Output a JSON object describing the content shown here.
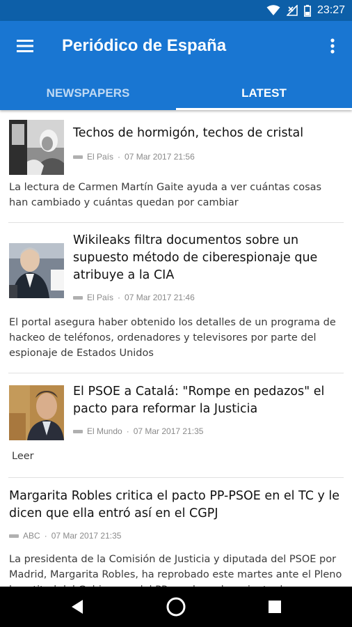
{
  "status_bar": {
    "time": "23:27",
    "icons": [
      "wifi-icon",
      "signal-off-icon",
      "battery-icon"
    ]
  },
  "app_bar": {
    "title": "Periódico de España",
    "menu_icon": "hamburger-menu-icon",
    "overflow_icon": "more-vert-icon"
  },
  "tabs": [
    {
      "label": "NEWSPAPERS",
      "active": false
    },
    {
      "label": "LATEST",
      "active": true
    }
  ],
  "articles": [
    {
      "headline": "Techos de hormigón, techos de cristal",
      "source": "El País",
      "timestamp": "07 Mar 2017 21:56",
      "summary": "La lectura de Carmen Martín Gaite ayuda a ver cuántas cosas han cambiado y cuántas quedan por cambiar"
    },
    {
      "headline": "Wikileaks filtra documentos sobre un supuesto método de ciberespionaje que atribuye a la CIA",
      "source": "El País",
      "timestamp": "07 Mar 2017 21:46",
      "summary": "El portal asegura haber obtenido los detalles de un programa de hackeo de teléfonos, ordenadores y televisores por parte del espionaje de Estados Unidos"
    },
    {
      "headline": "El PSOE a Catalá: \"Rompe en pedazos\" el pacto para reformar la Justicia",
      "source": "El Mundo",
      "timestamp": "07 Mar 2017 21:35",
      "summary": "Leer"
    },
    {
      "headline": "Margarita Robles critica el pacto PP-PSOE en el TC y le dicen que ella entró así en el CGPJ",
      "source": "ABC",
      "timestamp": "07 Mar 2017 21:35",
      "summary": "La presidenta de la Comisión de Justicia y diputada del PSOE por Madrid, Margarita Robles, ha reprobado este martes ante el Pleno la actitud del Gobierno y del PP en el nombramiento de magistrados"
    }
  ],
  "nav_bar": {
    "icons": [
      "back-icon",
      "home-icon",
      "recents-icon"
    ]
  }
}
